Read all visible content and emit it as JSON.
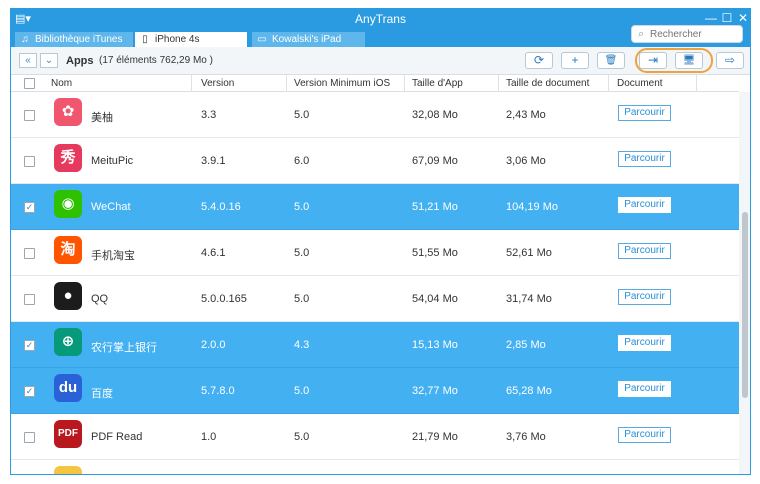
{
  "window": {
    "title": "AnyTrans",
    "menu_glyph": "▤▾",
    "minimize_glyph": "—",
    "maximize_glyph": "☐",
    "close_glyph": "✕"
  },
  "tabs": [
    {
      "label": "Bibliothèque iTunes",
      "icon": "music-note-icon",
      "glyph": "♫"
    },
    {
      "label": "iPhone 4s",
      "icon": "iphone-icon",
      "glyph": "▯"
    },
    {
      "label": "Kowalski's iPad",
      "icon": "ipad-icon",
      "glyph": "▭"
    }
  ],
  "search": {
    "placeholder": "Rechercher",
    "glyph": "⌕"
  },
  "toolbar": {
    "back_glyph": "«",
    "dropdown_glyph": "⌄",
    "title": "Apps",
    "count": "(17 éléments 762,29 Mo )",
    "refresh_glyph": "⟳",
    "add_glyph": "+",
    "delete_glyph": "🗑",
    "to_itunes_glyph": "⇥",
    "to_computer_glyph": "🖥",
    "to_device_glyph": "⇨"
  },
  "columns": [
    "Nom",
    "Version",
    "Version Minimum iOS",
    "Taille d'App",
    "Taille de document",
    "Document"
  ],
  "browse_label": "Parcourir",
  "check_glyph": "✓",
  "apps": [
    {
      "name": "美柚",
      "version": "3.3",
      "min_ios": "5.0",
      "app_size": "32,08 Mo",
      "doc_size": "2,43 Mo",
      "selected": false,
      "icon": "meiyou-app-icon",
      "color": "#f0566e",
      "glyph": "✿"
    },
    {
      "name": "MeituPic",
      "version": "3.9.1",
      "min_ios": "6.0",
      "app_size": "67,09 Mo",
      "doc_size": "3,06 Mo",
      "selected": false,
      "icon": "meitupic-app-icon",
      "color": "#e5395d",
      "glyph": "秀"
    },
    {
      "name": "WeChat",
      "version": "5.4.0.16",
      "min_ios": "5.0",
      "app_size": "51,21 Mo",
      "doc_size": "104,19 Mo",
      "selected": true,
      "icon": "wechat-app-icon",
      "color": "#2dc100",
      "glyph": "◉"
    },
    {
      "name": "手机淘宝",
      "version": "4.6.1",
      "min_ios": "5.0",
      "app_size": "51,55 Mo",
      "doc_size": "52,61 Mo",
      "selected": false,
      "icon": "taobao-app-icon",
      "color": "#ff5400",
      "glyph": "淘"
    },
    {
      "name": "QQ",
      "version": "5.0.0.165",
      "min_ios": "5.0",
      "app_size": "54,04 Mo",
      "doc_size": "31,74 Mo",
      "selected": false,
      "icon": "qq-penguin-app-icon",
      "color": "#1c1c1c",
      "glyph": "●"
    },
    {
      "name": "农行掌上银行",
      "version": "2.0.0",
      "min_ios": "4.3",
      "app_size": "15,13 Mo",
      "doc_size": "2,85 Mo",
      "selected": true,
      "icon": "abc-bank-app-icon",
      "color": "#079a7a",
      "glyph": "⊕"
    },
    {
      "name": "百度",
      "version": "5.7.8.0",
      "min_ios": "5.0",
      "app_size": "32,77 Mo",
      "doc_size": "65,28 Mo",
      "selected": true,
      "icon": "baidu-app-icon",
      "color": "#2a61d6",
      "glyph": "du"
    },
    {
      "name": "PDF Read",
      "version": "1.0",
      "min_ios": "5.0",
      "app_size": "21,79 Mo",
      "doc_size": "3,76 Mo",
      "selected": false,
      "icon": "pdf-read-app-icon",
      "color": "#b8181e",
      "glyph": "PDF"
    },
    {
      "name": "",
      "version": "",
      "min_ios": "",
      "app_size": "",
      "doc_size": "",
      "selected": false,
      "icon": "partial-app-icon",
      "color": "#f5c542",
      "glyph": ""
    }
  ]
}
